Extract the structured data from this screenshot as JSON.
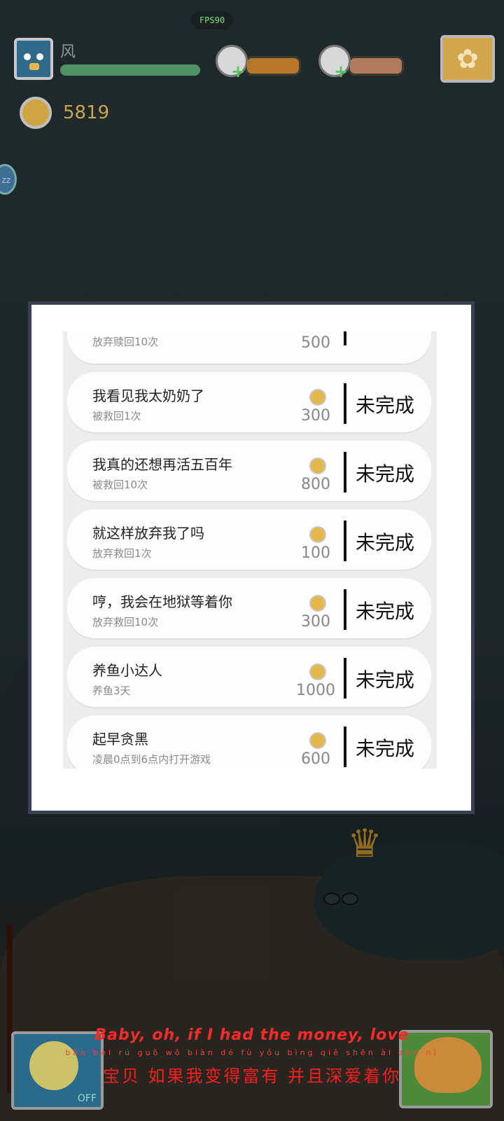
{
  "hud": {
    "fps": "FPS90",
    "player_name": "风",
    "coins": "5819",
    "settings_icon": "flower-gear-icon",
    "food_icon": "burger-icon",
    "drink_icon": "drink-bottle-icon",
    "plus_symbol": "+"
  },
  "sleep_button": {
    "label": "zz"
  },
  "achievements": {
    "status_label": "未完成",
    "items": [
      {
        "title": "",
        "desc": "放弃赎回10次",
        "reward": "500"
      },
      {
        "title": "我看见我太奶奶了",
        "desc": "被救回1次",
        "reward": "300"
      },
      {
        "title": "我真的还想再活五百年",
        "desc": "被救回10次",
        "reward": "800"
      },
      {
        "title": "就这样放弃我了吗",
        "desc": "放弃救回1次",
        "reward": "100"
      },
      {
        "title": "哼，我会在地狱等着你",
        "desc": "放弃救回10次",
        "reward": "300"
      },
      {
        "title": "养鱼小达人",
        "desc": "养鱼3天",
        "reward": "1000"
      },
      {
        "title": "起早贪黑",
        "desc": "凌晨0点到6点内打开游戏",
        "reward": "600"
      }
    ]
  },
  "bottom": {
    "toggle_label": "OFF",
    "lyric_en": "Baby, oh, if I had the money, love",
    "lyric_pinyin": "bǎo bèi  rú guǒ wǒ biàn dé fù yǒu  bìng qiě shēn ài zhe nǐ",
    "lyric_zh": "宝贝 如果我变得富有 并且深爱着你"
  },
  "colors": {
    "hp": "#4f9165",
    "food": "#b8762a",
    "drink": "#b07a5e",
    "coin": "#cfa543",
    "lyric": "#ff2a2a"
  }
}
